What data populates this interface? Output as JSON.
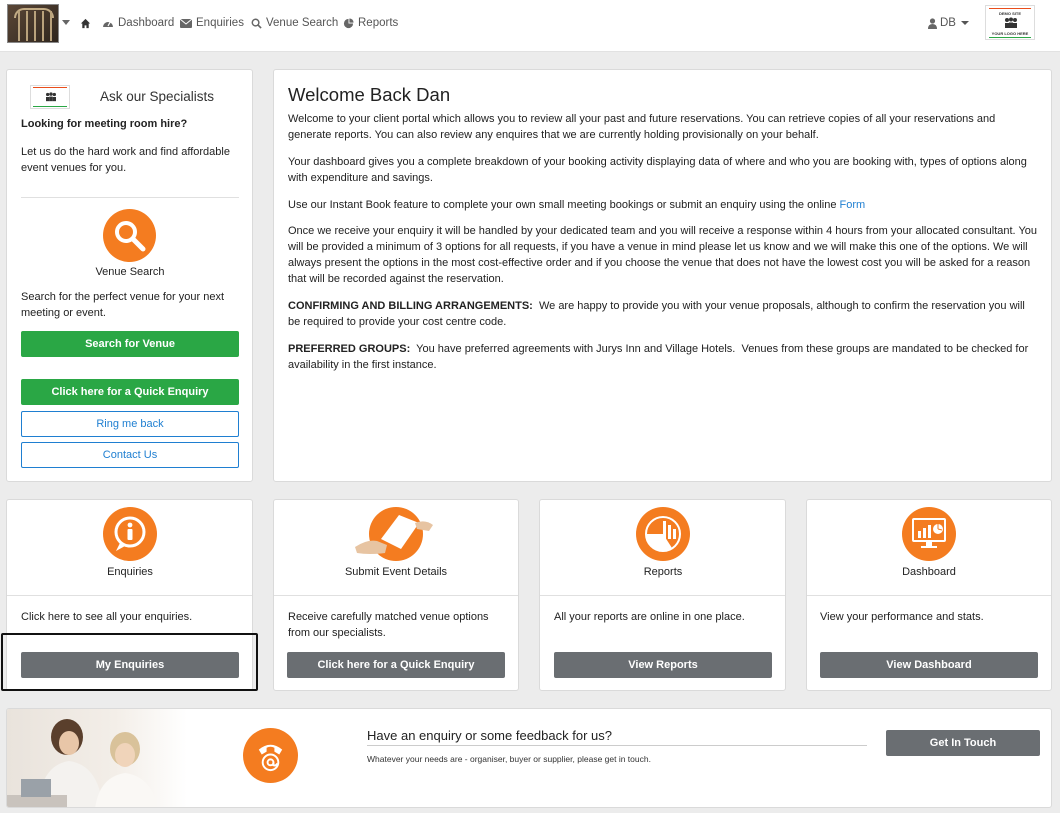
{
  "nav": {
    "home_label": "",
    "dashboard": "Dashboard",
    "enquiries": "Enquiries",
    "venue_search": "Venue Search",
    "reports": "Reports",
    "user_initials": "DB",
    "brand_top": "DEMO SITE",
    "brand_bottom": "YOUR LOGO HERE"
  },
  "specialists": {
    "title": "Ask our Specialists",
    "heading": "Looking for meeting room hire?",
    "text": "Let us do the hard work and find affordable event venues for you.",
    "circle_label": "Venue Search",
    "search_text": "Search for the perfect venue for your next meeting or event.",
    "search_button": "Search for Venue",
    "quick_enquiry_button": "Click here for a Quick Enquiry",
    "ring_button": "Ring me back",
    "contact_button": "Contact Us"
  },
  "welcome": {
    "title": "Welcome Back Dan",
    "p1": "Welcome to your client portal which allows you to review all your past and future reservations. You can retrieve copies of all your reservations and generate reports. You can also review any enquires that we are currently holding provisionally on your behalf.",
    "p2": "Your dashboard gives you a complete breakdown of your booking activity displaying data of where and who you are booking with, types of options along with expenditure and savings.",
    "p3_pre": "Use our Instant Book feature to complete your own small meeting bookings or submit an enquiry using the online ",
    "p3_link": "Form",
    "p4": "Once we receive your enquiry it will be handled by your dedicated team and you will receive a response within 4 hours from your allocated consultant.  You will be provided a minimum of 3 options for all requests, if you have a venue in mind please let us know and we will make this one of the options. We will always present the options in the most cost-effective order and if you choose the venue that does not have the lowest cost you will be asked for a reason that will be recorded against the reservation.",
    "p5_label": "CONFIRMING AND BILLING ARRANGEMENTS:",
    "p5_text": "  We are happy to provide you with your venue proposals, although to confirm the reservation you will be required to provide your cost centre code.",
    "p6_label": "PREFERRED GROUPS:",
    "p6_text": "  You have preferred agreements with Jurys Inn and Village Hotels.  Venues from these groups are mandated to be checked for availability in the first instance."
  },
  "features": [
    {
      "title": "Enquiries",
      "text": "Click here to see all your enquiries.",
      "button": "My Enquiries",
      "icon": "info-chat-icon"
    },
    {
      "title": "Submit Event Details",
      "text": "Receive carefully matched venue options from our specialists.",
      "button": "Click here for a Quick Enquiry",
      "icon": "hand-document-icon"
    },
    {
      "title": "Reports",
      "text": "All your reports are online in one place.",
      "button": "View Reports",
      "icon": "pie-chart-icon"
    },
    {
      "title": "Dashboard",
      "text": "View your performance and stats.",
      "button": "View Dashboard",
      "icon": "monitor-chart-icon"
    }
  ],
  "banner": {
    "heading": "Have an enquiry or some feedback for us?",
    "sub": "Whatever your needs are - organiser, buyer or supplier, please get in touch.",
    "button": "Get In Touch",
    "icon": "phone-at-icon"
  },
  "colors": {
    "accent_orange": "#f47c20",
    "green": "#2aa745",
    "link_blue": "#1f7fd1",
    "grey_button": "#6a6e72"
  }
}
